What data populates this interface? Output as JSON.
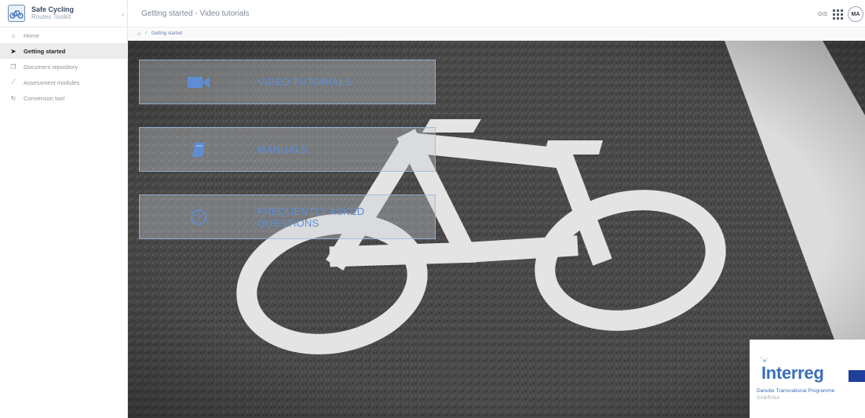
{
  "brand": {
    "title": "Safe Cycling",
    "subtitle": "Routes Toolkit",
    "collapse_icon": "chevron-left-icon"
  },
  "sidebar": {
    "items": [
      {
        "label": "Home",
        "icon": "home-icon",
        "active": false
      },
      {
        "label": "Getting started",
        "icon": "pointer-icon",
        "active": true
      },
      {
        "label": "Document repository",
        "icon": "documents-icon",
        "active": false
      },
      {
        "label": "Assessment modules",
        "icon": "chart-line-icon",
        "active": false
      },
      {
        "label": "Conversion tool",
        "icon": "refresh-icon",
        "active": false
      }
    ]
  },
  "header": {
    "title": "Getting started - Video tutorials",
    "gis_label": "GIS",
    "avatar_initials": "MA"
  },
  "breadcrumb": {
    "separator": "/",
    "current": "Getting started"
  },
  "main": {
    "cards": [
      {
        "label": "VIDEO TUTORIALS",
        "icon": "video-camera-icon"
      },
      {
        "label": "MANUALS",
        "icon": "book-icon"
      },
      {
        "label": "FREQUENTLY ASKED QUESTIONS",
        "icon": "question-circle-icon"
      }
    ]
  },
  "footer_logo": {
    "title": "Interreg",
    "subtitle": "Danube Transnational Programme",
    "project": "SABRINA"
  },
  "colors": {
    "accent": "#5d8ed4",
    "asphalt": "#4b4b4b",
    "paint": "#e4e4e4"
  }
}
